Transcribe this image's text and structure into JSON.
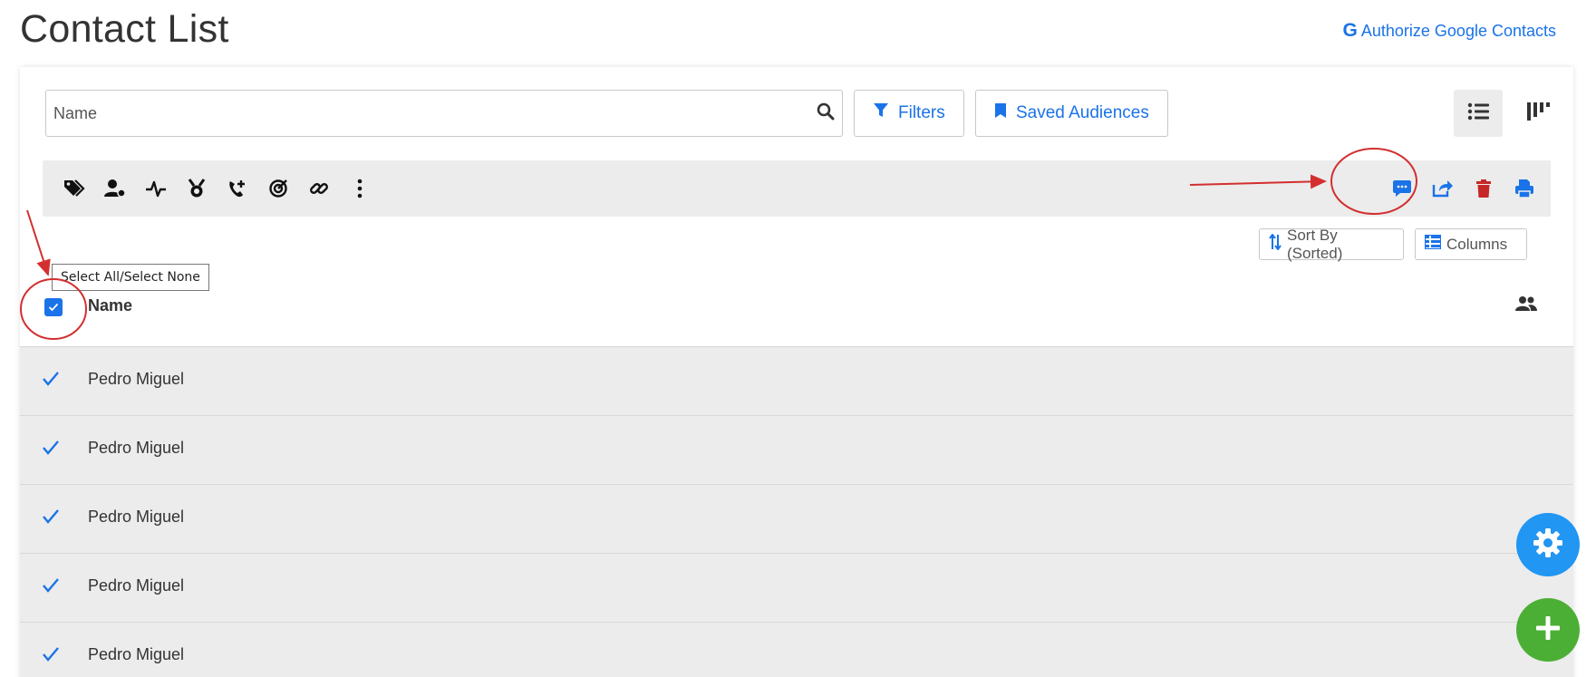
{
  "page": {
    "title": "Contact List",
    "auth_link": {
      "icon": "G",
      "label": "Authorize Google Contacts"
    }
  },
  "search": {
    "placeholder": "Name",
    "value": ""
  },
  "buttons": {
    "filters": "Filters",
    "saved_audiences": "Saved Audiences",
    "sort_by": "Sort By (Sorted)",
    "columns": "Columns"
  },
  "view_toggle": {
    "active": "list-view",
    "options": [
      "list-view-icon",
      "board-view-icon"
    ]
  },
  "toolbar": {
    "left_icons": [
      "tag-icon",
      "assign-user-icon",
      "activity-icon",
      "award-icon",
      "add-call-icon",
      "target-icon",
      "link-icon",
      "more-vertical-icon"
    ],
    "right_icons": [
      "message-icon",
      "share-icon",
      "trash-icon",
      "print-icon"
    ]
  },
  "table": {
    "select_all_checked": true,
    "select_all_tooltip": "Select All/Select None",
    "name_header": "Name",
    "rows": [
      {
        "name": "Pedro Miguel",
        "selected": true
      },
      {
        "name": "Pedro Miguel",
        "selected": true
      },
      {
        "name": "Pedro Miguel",
        "selected": true
      },
      {
        "name": "Pedro Miguel",
        "selected": true
      },
      {
        "name": "Pedro Miguel",
        "selected": true
      }
    ]
  },
  "colors": {
    "accent": "#1a73e8",
    "danger": "#c62828",
    "fab_settings": "#2196f3",
    "fab_add": "#4caf35",
    "annotation": "#d32f2f",
    "row_bg": "#ececec"
  }
}
